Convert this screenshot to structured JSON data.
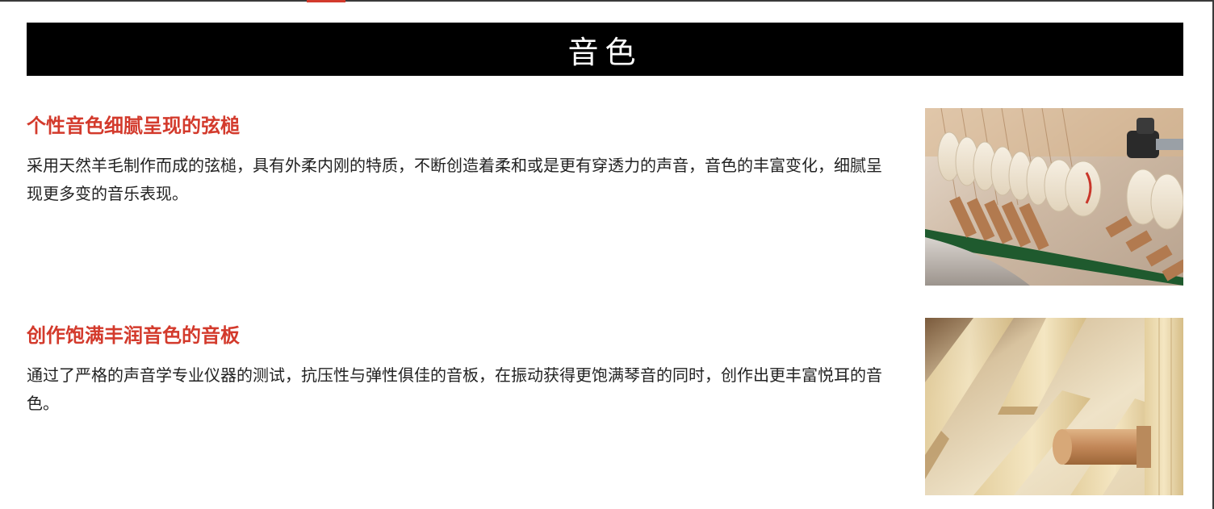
{
  "section": {
    "title": "音色"
  },
  "features": [
    {
      "title": "个性音色细腻呈现的弦槌",
      "description": "采用天然羊毛制作而成的弦槌，具有外柔内刚的特质，不断创造着柔和或是更有穿透力的声音，音色的丰富变化，细腻呈现更多变的音乐表现。",
      "image": "piano-hammers-photo"
    },
    {
      "title": "创作饱满丰润音色的音板",
      "description": "通过了严格的声音学专业仪器的测试，抗压性与弹性俱佳的音板，在振动获得更饱满琴音的同时，创作出更丰富悦耳的音色。",
      "image": "soundboard-photo"
    }
  ],
  "colors": {
    "accent": "#d33a2c",
    "title_bar_bg": "#000000",
    "title_text": "#ffffff",
    "body_text": "#222222"
  }
}
